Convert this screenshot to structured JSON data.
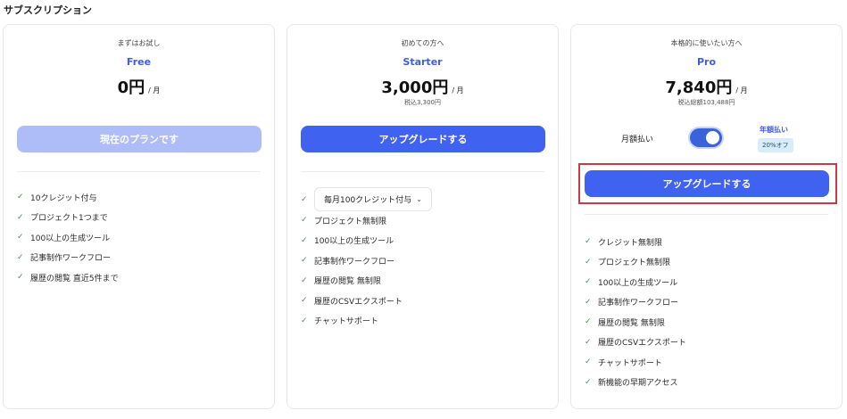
{
  "section_title": "サブスクリプション",
  "plans": [
    {
      "tagline": "まずはお試し",
      "name": "Free",
      "price": "0円",
      "per": "/ 月",
      "button": "現在のプランです",
      "features": [
        "10クレジット付与",
        "プロジェクト1つまで",
        "100以上の生成ツール",
        "記事制作ワークフロー",
        "履歴の閲覧 直近5件まで"
      ]
    },
    {
      "tagline": "初めての方へ",
      "name": "Starter",
      "price": "3,000円",
      "per": "/ 月",
      "tax": "税込3,300円",
      "button": "アップグレードする",
      "credit_select": "毎月100クレジット付与",
      "features": [
        "プロジェクト無制限",
        "100以上の生成ツール",
        "記事制作ワークフロー",
        "履歴の閲覧 無制限",
        "履歴のCSVエクスポート",
        "チャットサポート"
      ]
    },
    {
      "tagline": "本格的に使いたい方へ",
      "name": "Pro",
      "price": "7,840円",
      "per": "/ 月",
      "tax": "税込総額103,488円",
      "billing_monthly": "月額払い",
      "billing_yearly": "年額払い",
      "discount": "20%オフ",
      "button": "アップグレードする",
      "features": [
        "クレジット無制限",
        "プロジェクト無制限",
        "100以上の生成ツール",
        "記事制作ワークフロー",
        "履歴の閲覧 無制限",
        "履歴のCSVエクスポート",
        "チャットサポート",
        "新機能の早期アクセス"
      ]
    }
  ],
  "colors": {
    "accent": "#4062f0",
    "accent_disabled": "#aebcf8",
    "plan_name": "#3f5de0",
    "check": "#4c8f4c",
    "highlight_border": "#c73a47"
  },
  "icons": {
    "check": "check-icon",
    "chevron": "chevron-down-icon"
  }
}
